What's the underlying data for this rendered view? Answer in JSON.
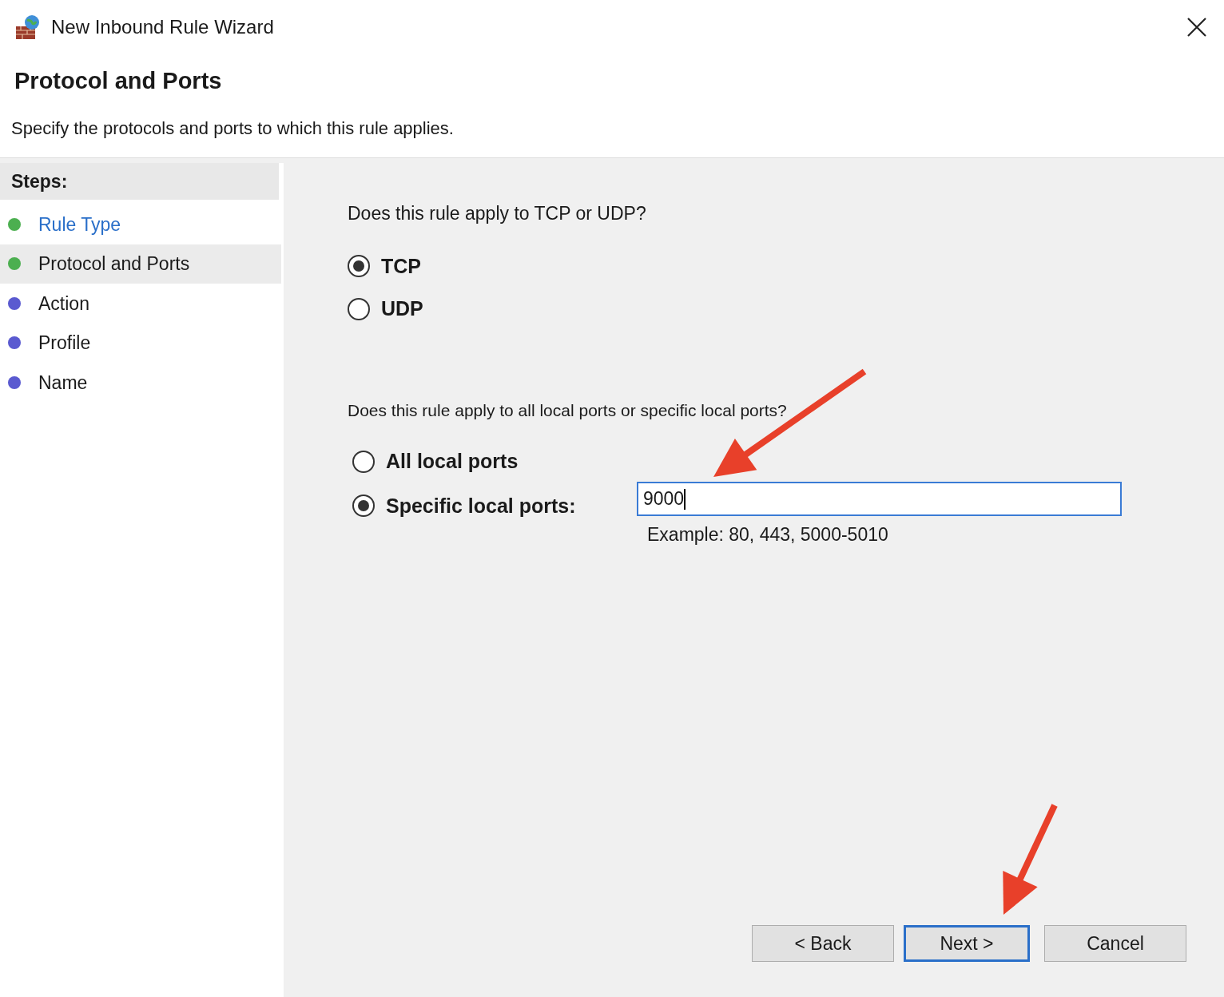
{
  "window": {
    "title": "New Inbound Rule Wizard"
  },
  "header": {
    "title": "Protocol and Ports",
    "subtitle": "Specify the protocols and ports to which this rule applies."
  },
  "steps": {
    "heading": "Steps:",
    "items": [
      {
        "label": "Rule Type",
        "selected": false,
        "link": true,
        "color": "#4caf50"
      },
      {
        "label": "Protocol and Ports",
        "selected": true,
        "link": false,
        "color": "#4caf50"
      },
      {
        "label": "Action",
        "selected": false,
        "link": false,
        "color": "#5a5ad0"
      },
      {
        "label": "Profile",
        "selected": false,
        "link": false,
        "color": "#5a5ad0"
      },
      {
        "label": "Name",
        "selected": false,
        "link": false,
        "color": "#5a5ad0"
      }
    ]
  },
  "protocol": {
    "question": "Does this rule apply to TCP or UDP?",
    "options": [
      {
        "label": "TCP",
        "selected": true
      },
      {
        "label": "UDP",
        "selected": false
      }
    ]
  },
  "ports": {
    "question": "Does this rule apply to all local ports or specific local ports?",
    "options": [
      {
        "label": "All local ports",
        "selected": false
      },
      {
        "label": "Specific local ports:",
        "selected": true
      }
    ],
    "field": {
      "value": "9000"
    },
    "example": "Example: 80, 443, 5000-5010"
  },
  "buttons": [
    {
      "label": "< Back",
      "focused": false
    },
    {
      "label": "Next >",
      "focused": true
    },
    {
      "label": "Cancel",
      "focused": false
    }
  ]
}
